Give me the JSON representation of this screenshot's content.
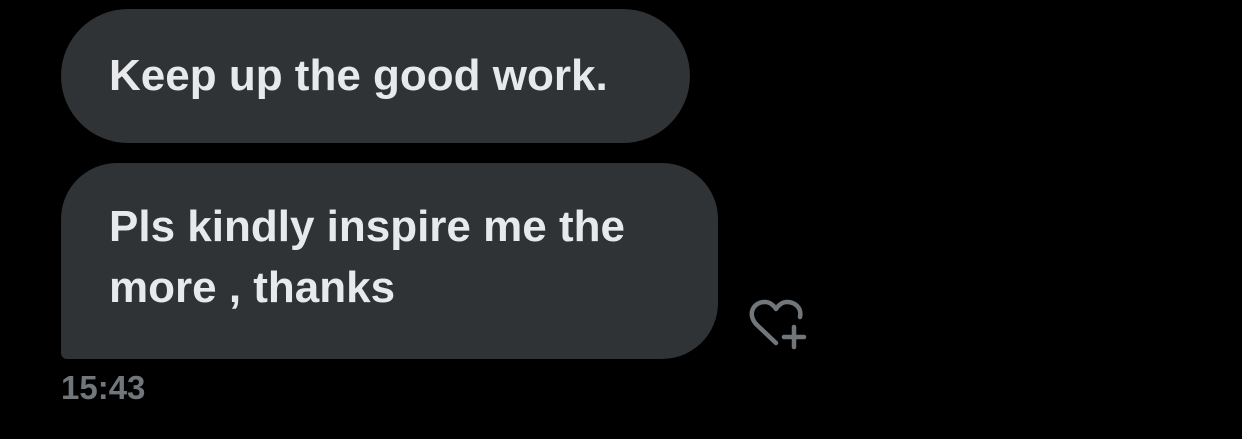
{
  "messages": [
    {
      "text": "Keep up the good work."
    },
    {
      "text": "Pls kindly inspire me the more , thanks"
    }
  ],
  "timestamp": "15:43",
  "icons": {
    "reaction": "heart-plus-icon"
  },
  "colors": {
    "background": "#000000",
    "bubble": "#2f3336",
    "text": "#e7e9ea",
    "muted": "#71767b"
  }
}
